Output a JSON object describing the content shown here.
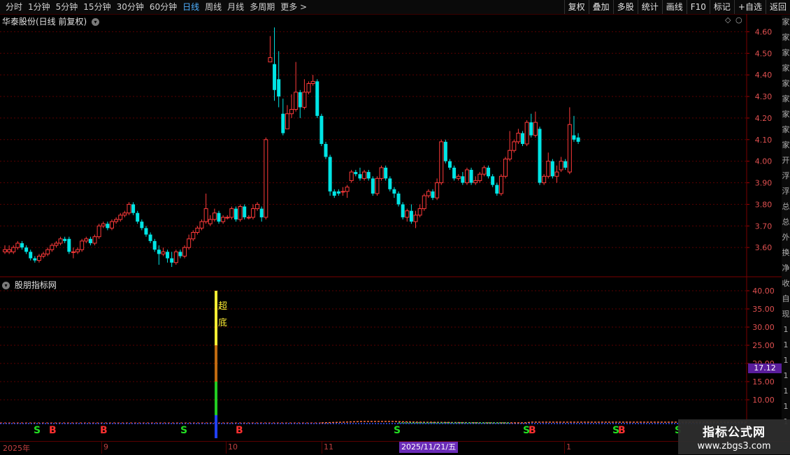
{
  "toolbar": {
    "periods": [
      "分时",
      "1分钟",
      "5分钟",
      "15分钟",
      "30分钟",
      "60分钟",
      "日线",
      "周线",
      "月线",
      "多周期",
      "更多 >"
    ],
    "active_period": "日线",
    "right_buttons": [
      "复权",
      "叠加",
      "多股",
      "统计",
      "画线",
      "F10",
      "标记",
      "+自选",
      "返回"
    ]
  },
  "main_panel": {
    "title": "华泰股份(日线 前复权)",
    "price_ticks": [
      "4.60",
      "4.50",
      "4.40",
      "4.30",
      "4.20",
      "4.10",
      "4.00",
      "3.90",
      "3.80",
      "3.70",
      "3.60"
    ]
  },
  "indicator_panel": {
    "title": "股朋指标网",
    "ticks": [
      "40.00",
      "35.00",
      "30.00",
      "25.00",
      "20.00",
      "15.00",
      "10.00"
    ],
    "current_value": "17.12",
    "signal_text": [
      "超",
      "底"
    ]
  },
  "signals": [
    {
      "label": "S",
      "color": "#22dd22"
    },
    {
      "label": "B",
      "color": "#ff3030"
    },
    {
      "label": "B",
      "color": "#ff3030"
    },
    {
      "label": "S",
      "color": "#22dd22"
    },
    {
      "label": "B",
      "color": "#ff3030"
    },
    {
      "label": "S",
      "color": "#22dd22"
    },
    {
      "label": "S",
      "color": "#22dd22"
    },
    {
      "label": "B",
      "color": "#ff3030"
    },
    {
      "label": "S",
      "color": "#22dd22"
    },
    {
      "label": "B",
      "color": "#ff3030"
    },
    {
      "label": "S",
      "color": "#22dd22"
    }
  ],
  "date_axis": {
    "labels": [
      "2025年",
      "9",
      "10",
      "11",
      "1"
    ],
    "cursor_date": "2025/11/21/五"
  },
  "right_strip_chars": [
    "家",
    "家",
    "家",
    "家",
    "家",
    "家",
    "家",
    "家",
    "家",
    "开",
    "浮",
    "浮",
    "总",
    "总",
    "外",
    "换",
    "净",
    "收",
    "自",
    "现",
    "1",
    "1",
    "1",
    "1",
    "1",
    "1",
    "1"
  ],
  "watermark": {
    "line1": "指标公式网",
    "line2": "www.zbgs3.com"
  },
  "colors": {
    "up": "#ff3a3a",
    "down": "#00e5e5",
    "grid": "#5a0000",
    "axis_text": "#e05050"
  },
  "chart_data": {
    "type": "candlestick",
    "ylim": [
      3.5,
      4.65
    ],
    "candles": [
      [
        3.58,
        3.59,
        3.61,
        3.57
      ],
      [
        3.58,
        3.59,
        3.61,
        3.57
      ],
      [
        3.58,
        3.6,
        3.61,
        3.57
      ],
      [
        3.6,
        3.62,
        3.63,
        3.59
      ],
      [
        3.62,
        3.6,
        3.63,
        3.59
      ],
      [
        3.6,
        3.58,
        3.61,
        3.57
      ],
      [
        3.58,
        3.55,
        3.59,
        3.54
      ],
      [
        3.55,
        3.54,
        3.56,
        3.53
      ],
      [
        3.54,
        3.56,
        3.57,
        3.53
      ],
      [
        3.56,
        3.57,
        3.58,
        3.55
      ],
      [
        3.57,
        3.59,
        3.6,
        3.56
      ],
      [
        3.59,
        3.61,
        3.62,
        3.58
      ],
      [
        3.61,
        3.62,
        3.63,
        3.6
      ],
      [
        3.62,
        3.64,
        3.65,
        3.61
      ],
      [
        3.64,
        3.63,
        3.65,
        3.62
      ],
      [
        3.64,
        3.58,
        3.65,
        3.57
      ],
      [
        3.58,
        3.58,
        3.6,
        3.55
      ],
      [
        3.58,
        3.59,
        3.6,
        3.57
      ],
      [
        3.59,
        3.63,
        3.64,
        3.58
      ],
      [
        3.63,
        3.64,
        3.65,
        3.62
      ],
      [
        3.64,
        3.62,
        3.65,
        3.61
      ],
      [
        3.62,
        3.65,
        3.66,
        3.61
      ],
      [
        3.65,
        3.7,
        3.71,
        3.64
      ],
      [
        3.7,
        3.71,
        3.72,
        3.69
      ],
      [
        3.71,
        3.69,
        3.72,
        3.68
      ],
      [
        3.69,
        3.72,
        3.73,
        3.68
      ],
      [
        3.72,
        3.73,
        3.74,
        3.71
      ],
      [
        3.73,
        3.75,
        3.76,
        3.72
      ],
      [
        3.75,
        3.76,
        3.77,
        3.74
      ],
      [
        3.76,
        3.8,
        3.81,
        3.75
      ],
      [
        3.8,
        3.76,
        3.81,
        3.75
      ],
      [
        3.76,
        3.72,
        3.77,
        3.71
      ],
      [
        3.72,
        3.69,
        3.73,
        3.68
      ],
      [
        3.69,
        3.66,
        3.7,
        3.65
      ],
      [
        3.66,
        3.63,
        3.67,
        3.62
      ],
      [
        3.63,
        3.59,
        3.64,
        3.58
      ],
      [
        3.59,
        3.57,
        3.61,
        3.52
      ],
      [
        3.57,
        3.58,
        3.6,
        3.56
      ],
      [
        3.58,
        3.55,
        3.59,
        3.53
      ],
      [
        3.55,
        3.53,
        3.58,
        3.51
      ],
      [
        3.53,
        3.58,
        3.59,
        3.52
      ],
      [
        3.58,
        3.56,
        3.59,
        3.55
      ],
      [
        3.56,
        3.6,
        3.61,
        3.55
      ],
      [
        3.6,
        3.64,
        3.66,
        3.59
      ],
      [
        3.64,
        3.67,
        3.68,
        3.63
      ],
      [
        3.67,
        3.69,
        3.7,
        3.66
      ],
      [
        3.69,
        3.72,
        3.73,
        3.68
      ],
      [
        3.72,
        3.78,
        3.85,
        3.71
      ],
      [
        3.71,
        3.73,
        3.75,
        3.7
      ],
      [
        3.73,
        3.76,
        3.78,
        3.72
      ],
      [
        3.76,
        3.72,
        3.77,
        3.71
      ],
      [
        3.72,
        3.74,
        3.75,
        3.71
      ],
      [
        3.74,
        3.74,
        3.75,
        3.73
      ],
      [
        3.74,
        3.78,
        3.79,
        3.73
      ],
      [
        3.78,
        3.73,
        3.79,
        3.72
      ],
      [
        3.73,
        3.79,
        3.8,
        3.72
      ],
      [
        3.79,
        3.74,
        3.8,
        3.73
      ],
      [
        3.74,
        3.74,
        3.75,
        3.73
      ],
      [
        3.74,
        3.78,
        3.8,
        3.73
      ],
      [
        3.78,
        3.8,
        3.81,
        3.77
      ],
      [
        3.78,
        3.74,
        3.79,
        3.72
      ],
      [
        3.74,
        4.1,
        4.11,
        3.73
      ],
      [
        4.46,
        4.48,
        4.58,
        4.46
      ],
      [
        4.45,
        4.33,
        4.62,
        4.28
      ],
      [
        4.38,
        4.3,
        4.51,
        4.25
      ],
      [
        4.22,
        4.13,
        4.29,
        4.12
      ],
      [
        4.15,
        4.22,
        4.26,
        4.15
      ],
      [
        4.22,
        4.24,
        4.31,
        4.2
      ],
      [
        4.24,
        4.32,
        4.46,
        4.23
      ],
      [
        4.32,
        4.25,
        4.33,
        4.2
      ],
      [
        4.25,
        4.32,
        4.38,
        4.24
      ],
      [
        4.32,
        4.36,
        4.37,
        4.31
      ],
      [
        4.36,
        4.37,
        4.4,
        4.35
      ],
      [
        4.37,
        4.21,
        4.38,
        4.2
      ],
      [
        4.21,
        4.08,
        4.22,
        4.07
      ],
      [
        4.08,
        4.02,
        4.09,
        4.01
      ],
      [
        4.02,
        3.86,
        4.03,
        3.84
      ],
      [
        3.86,
        3.84,
        3.87,
        3.83
      ],
      [
        3.86,
        3.85,
        3.87,
        3.84
      ],
      [
        3.86,
        3.86,
        3.88,
        3.84
      ],
      [
        3.86,
        3.88,
        3.89,
        3.83
      ],
      [
        3.91,
        3.95,
        3.96,
        3.9
      ],
      [
        3.95,
        3.94,
        3.96,
        3.93
      ],
      [
        3.94,
        3.92,
        3.97,
        3.91
      ],
      [
        3.92,
        3.95,
        3.96,
        3.91
      ],
      [
        3.95,
        3.92,
        3.96,
        3.91
      ],
      [
        3.92,
        3.85,
        3.93,
        3.84
      ],
      [
        3.85,
        3.92,
        3.93,
        3.84
      ],
      [
        3.92,
        3.97,
        3.98,
        3.91
      ],
      [
        3.97,
        3.92,
        3.98,
        3.91
      ],
      [
        3.92,
        3.87,
        3.93,
        3.86
      ],
      [
        3.87,
        3.85,
        3.88,
        3.83
      ],
      [
        3.85,
        3.8,
        3.86,
        3.79
      ],
      [
        3.8,
        3.74,
        3.81,
        3.73
      ],
      [
        3.74,
        3.77,
        3.78,
        3.72
      ],
      [
        3.77,
        3.72,
        3.8,
        3.71
      ],
      [
        3.72,
        3.75,
        3.77,
        3.69
      ],
      [
        3.75,
        3.78,
        3.8,
        3.74
      ],
      [
        3.78,
        3.84,
        3.85,
        3.77
      ],
      [
        3.84,
        3.86,
        3.87,
        3.83
      ],
      [
        3.86,
        3.83,
        3.87,
        3.82
      ],
      [
        3.83,
        3.9,
        3.92,
        3.82
      ],
      [
        3.9,
        4.09,
        4.1,
        3.89
      ],
      [
        4.09,
        4.0,
        4.1,
        3.99
      ],
      [
        4.0,
        3.97,
        4.01,
        3.96
      ],
      [
        3.97,
        3.92,
        3.98,
        3.91
      ],
      [
        3.92,
        3.93,
        3.94,
        3.91
      ],
      [
        3.93,
        3.9,
        3.95,
        3.89
      ],
      [
        3.9,
        3.96,
        3.97,
        3.89
      ],
      [
        3.96,
        3.9,
        3.97,
        3.89
      ],
      [
        3.9,
        3.91,
        3.93,
        3.89
      ],
      [
        3.91,
        3.94,
        3.95,
        3.9
      ],
      [
        3.94,
        3.97,
        3.98,
        3.93
      ],
      [
        3.97,
        3.93,
        3.98,
        3.92
      ],
      [
        3.93,
        3.89,
        3.94,
        3.88
      ],
      [
        3.89,
        3.85,
        3.9,
        3.84
      ],
      [
        3.85,
        3.93,
        3.94,
        3.84
      ],
      [
        3.93,
        4.01,
        4.02,
        3.92
      ],
      [
        4.01,
        4.05,
        4.14,
        4.0
      ],
      [
        4.05,
        4.09,
        4.1,
        4.04
      ],
      [
        4.09,
        4.13,
        4.15,
        4.08
      ],
      [
        4.13,
        4.08,
        4.14,
        4.07
      ],
      [
        4.08,
        4.18,
        4.19,
        4.07
      ],
      [
        4.18,
        4.12,
        4.22,
        4.11
      ],
      [
        4.12,
        4.18,
        4.23,
        4.11
      ],
      [
        4.15,
        3.9,
        4.16,
        3.89
      ],
      [
        3.9,
        3.93,
        3.94,
        3.89
      ],
      [
        3.93,
        4.0,
        4.04,
        3.92
      ],
      [
        4.0,
        3.93,
        4.01,
        3.92
      ],
      [
        3.93,
        3.95,
        3.98,
        3.9
      ],
      [
        3.96,
        4.0,
        4.02,
        3.95
      ],
      [
        4.0,
        3.97,
        4.01,
        3.96
      ],
      [
        3.95,
        4.17,
        4.25,
        3.94
      ],
      [
        4.12,
        4.1,
        4.21,
        4.09
      ],
      [
        4.11,
        4.09,
        4.13,
        4.08
      ]
    ]
  }
}
